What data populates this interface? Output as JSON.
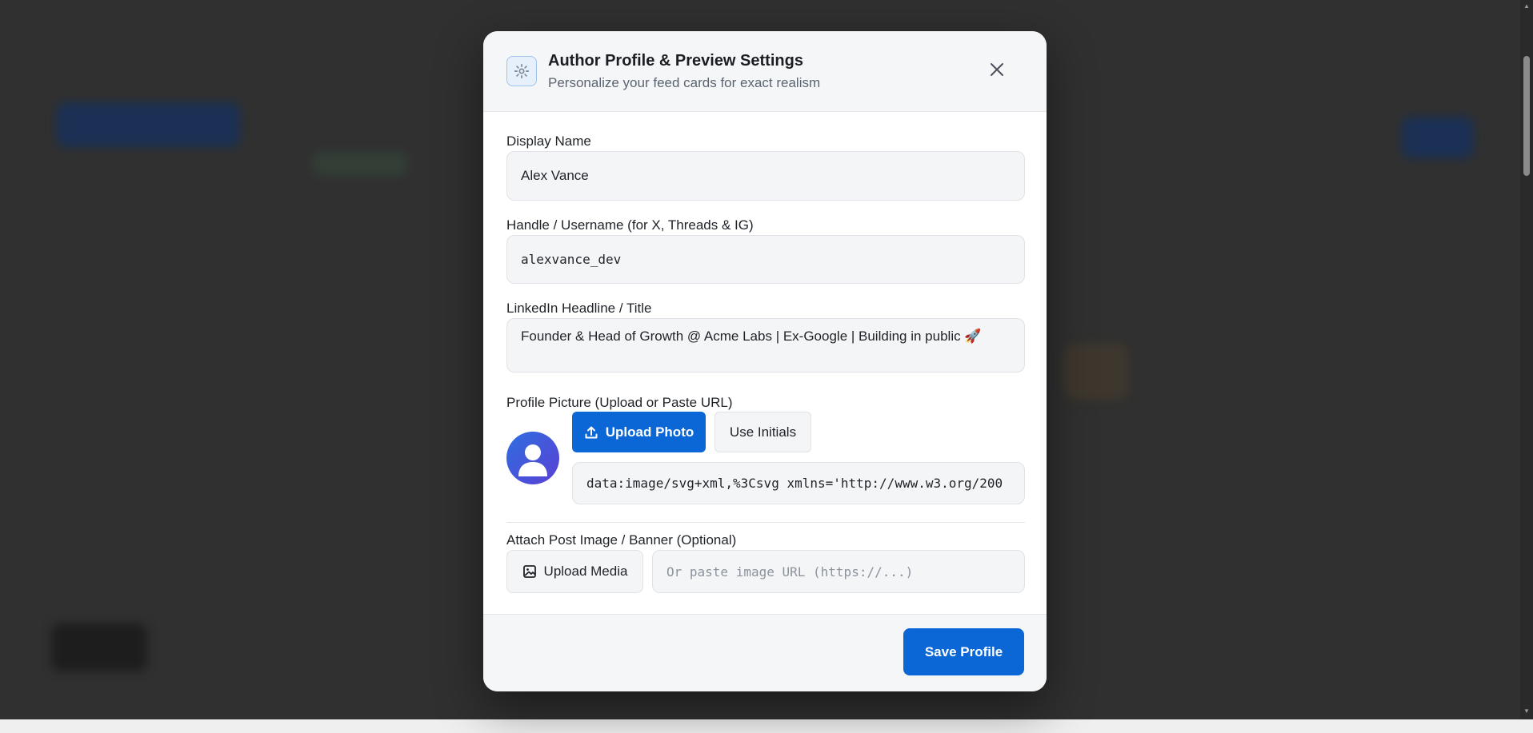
{
  "modal": {
    "icon": "gear-icon",
    "title": "Author Profile & Preview Settings",
    "subtitle": "Personalize your feed cards for exact realism",
    "close_icon": "close-icon"
  },
  "fields": {
    "display_name": {
      "label": "Display Name",
      "value": "Alex Vance"
    },
    "handle": {
      "label": "Handle / Username (for X, Threads & IG)",
      "value": "alexvance_dev"
    },
    "headline": {
      "label": "LinkedIn Headline / Title",
      "value": "Founder & Head of Growth @ Acme Labs | Ex-Google | Building in public 🚀"
    },
    "profile_picture": {
      "label": "Profile Picture (Upload or Paste URL)",
      "upload_label": "Upload Photo",
      "initials_label": "Use Initials",
      "url_value": "data:image/svg+xml,%3Csvg xmlns='http://www.w3.org/200"
    },
    "post_image": {
      "label": "Attach Post Image / Banner (Optional)",
      "upload_label": "Upload Media",
      "url_placeholder": "Or paste image URL (https://...)"
    }
  },
  "footer": {
    "save_label": "Save Profile"
  },
  "colors": {
    "primary": "#0b66d6",
    "avatar_gradient_start": "#2f6fe0",
    "avatar_gradient_end": "#5b3fd4"
  }
}
